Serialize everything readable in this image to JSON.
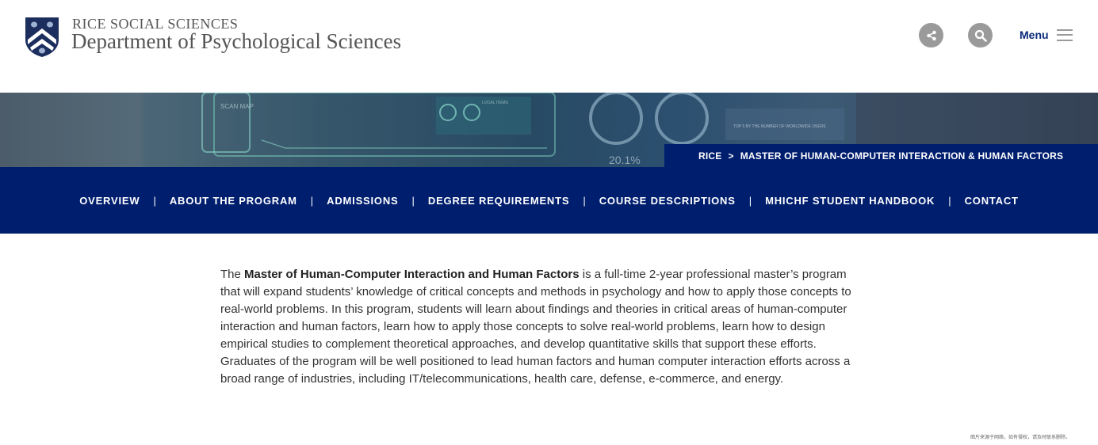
{
  "header": {
    "brand_top": "RICE SOCIAL SCIENCES",
    "brand_main": "Department of Psychological Sciences",
    "logo_icon": "rice-owl-shield-icon",
    "share_icon": "share-icon",
    "search_icon": "search-icon",
    "menu_label": "Menu",
    "menu_icon": "hamburger-icon"
  },
  "breadcrumb": {
    "home": "RICE",
    "separator": ">",
    "current": "MASTER OF HUMAN-COMPUTER INTERACTION & HUMAN FACTORS"
  },
  "banner": {
    "screen_texts": [
      "SCAN MAP",
      "LOCAL ITEMS",
      "TOP 5 BY THE NUMBER OF WORLDWIDE USERS",
      "20.1%"
    ]
  },
  "nav": {
    "items": [
      "OVERVIEW",
      "ABOUT THE PROGRAM",
      "ADMISSIONS",
      "DEGREE REQUIREMENTS",
      "COURSE DESCRIPTIONS",
      "MHICHF STUDENT HANDBOOK",
      "CONTACT"
    ],
    "separator": "|"
  },
  "content": {
    "intro_prefix": "The ",
    "intro_bold": "Master of Human-Computer Interaction and Human Factors",
    "intro_rest": " is a full-time 2-year professional master’s program that will expand students’ knowledge of critical concepts and methods in psychology and how to apply those concepts to real-world problems. In this program, students will learn about findings and theories in critical areas of human-computer interaction and human factors, learn how to apply those concepts to solve real-world problems, learn how to design empirical studies to complement theoretical approaches, and develop quantitative skills that support these efforts. Graduates of the program will be well positioned to lead human factors and human computer interaction efforts across a broad range of industries, including IT/telecommunications, health care, defense, e-commerce, and energy."
  },
  "watermark": "图片来源于网络，如有侵权，请及时联系删除。",
  "colors": {
    "navy": "#001e6e",
    "menu_text": "#0a2a7a",
    "icon_gray": "#9a9a9a"
  }
}
